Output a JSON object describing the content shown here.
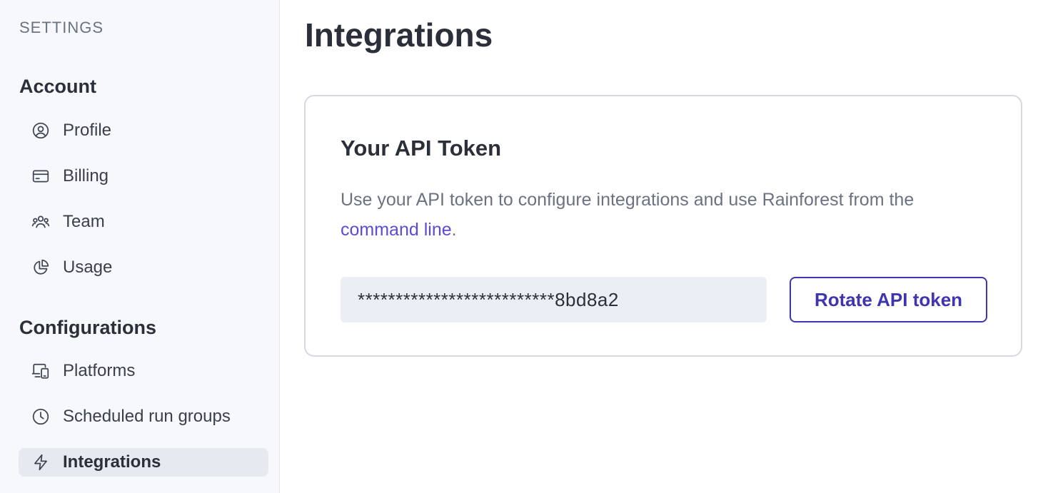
{
  "sidebar": {
    "settings_label": "SETTINGS",
    "account_heading": "Account",
    "account_items": [
      {
        "label": "Profile",
        "icon": "user-circle-icon"
      },
      {
        "label": "Billing",
        "icon": "credit-card-icon"
      },
      {
        "label": "Team",
        "icon": "users-icon"
      },
      {
        "label": "Usage",
        "icon": "chart-pie-icon"
      }
    ],
    "configurations_heading": "Configurations",
    "configuration_items": [
      {
        "label": "Platforms",
        "icon": "devices-icon"
      },
      {
        "label": "Scheduled run groups",
        "icon": "clock-icon"
      },
      {
        "label": "Integrations",
        "icon": "lightning-bolt-icon",
        "active": true
      }
    ]
  },
  "main": {
    "page_title": "Integrations",
    "card": {
      "title": "Your API Token",
      "description_prefix": "Use your API token to configure integrations and use Rainforest from the ",
      "description_link": "command line",
      "description_suffix": ".",
      "token_value": "**************************8bd8a2",
      "rotate_button_label": "Rotate API token"
    }
  },
  "colors": {
    "sidebar_bg": "#f6f8fb",
    "active_item_bg": "#e6e9f0",
    "link": "#5b4bd6",
    "button_accent": "#3f35b0",
    "token_field_bg": "#ebeef5"
  }
}
